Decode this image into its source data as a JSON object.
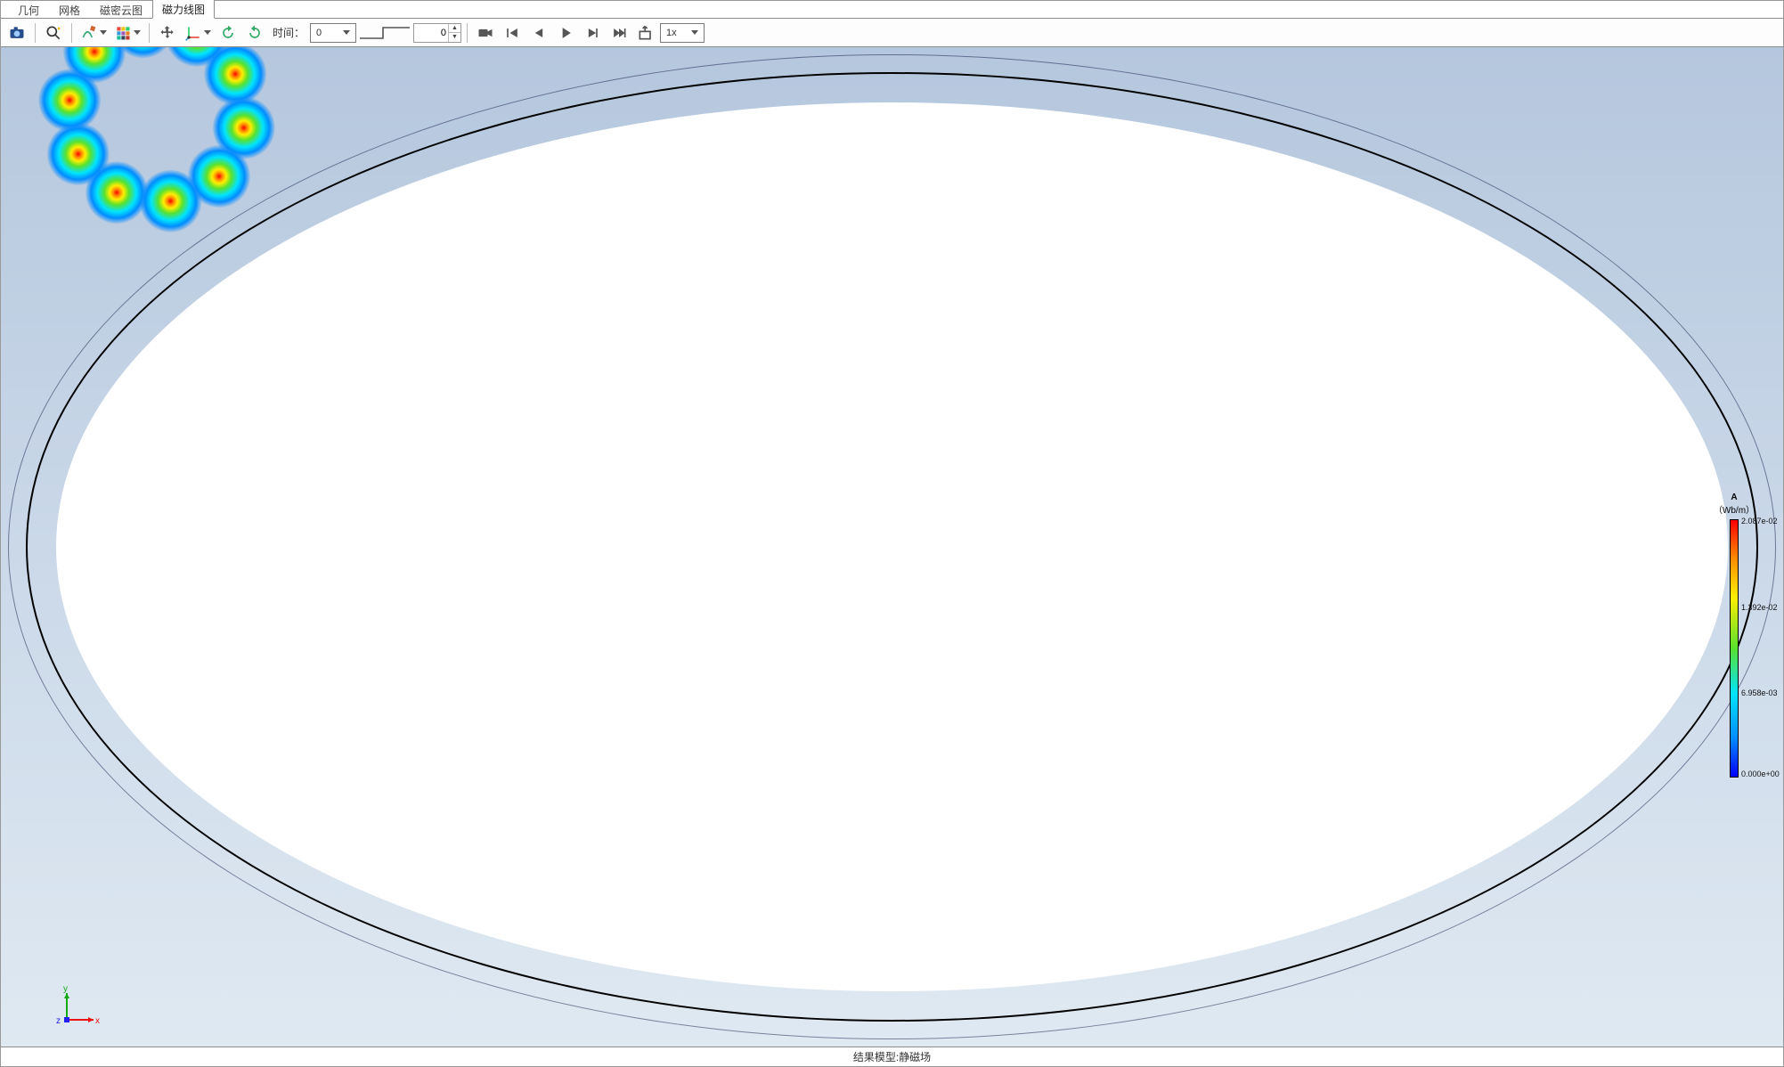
{
  "tabs": {
    "items": [
      {
        "label": "几何"
      },
      {
        "label": "网格"
      },
      {
        "label": "磁密云图"
      },
      {
        "label": "磁力线图"
      }
    ],
    "active_index": 3
  },
  "toolbar": {
    "screenshot_btn": "screenshot",
    "fit_btn": "zoom-fit",
    "brush_btn": "appearance",
    "cube_btn": "view-cube",
    "pan_btn": "pan",
    "axis_btn": "axis-orient",
    "rotcw_btn": "rotate-cw",
    "rotccw_btn": "rotate-ccw",
    "time_label": "时间：",
    "time_value": "0",
    "step_value": "0",
    "anim_camera": "camera-record",
    "anim_first": "first-frame",
    "anim_prev": "prev-frame",
    "anim_play": "play",
    "anim_next": "next-frame",
    "anim_last": "last-frame",
    "anim_export": "export-animation",
    "speed_value": "1x"
  },
  "triad": {
    "x_label": "x",
    "y_label": "y",
    "z_label": "z"
  },
  "legend": {
    "title1": "A",
    "title2": "（Wb/m）",
    "ticks": [
      {
        "pos": 0,
        "label": "2.087e-02"
      },
      {
        "pos": 0.333,
        "label": "1.392e-02"
      },
      {
        "pos": 0.666,
        "label": "6.958e-03"
      },
      {
        "pos": 1.0,
        "label": "0.000e+00"
      }
    ]
  },
  "status": {
    "text": "结果模型:静磁场"
  }
}
